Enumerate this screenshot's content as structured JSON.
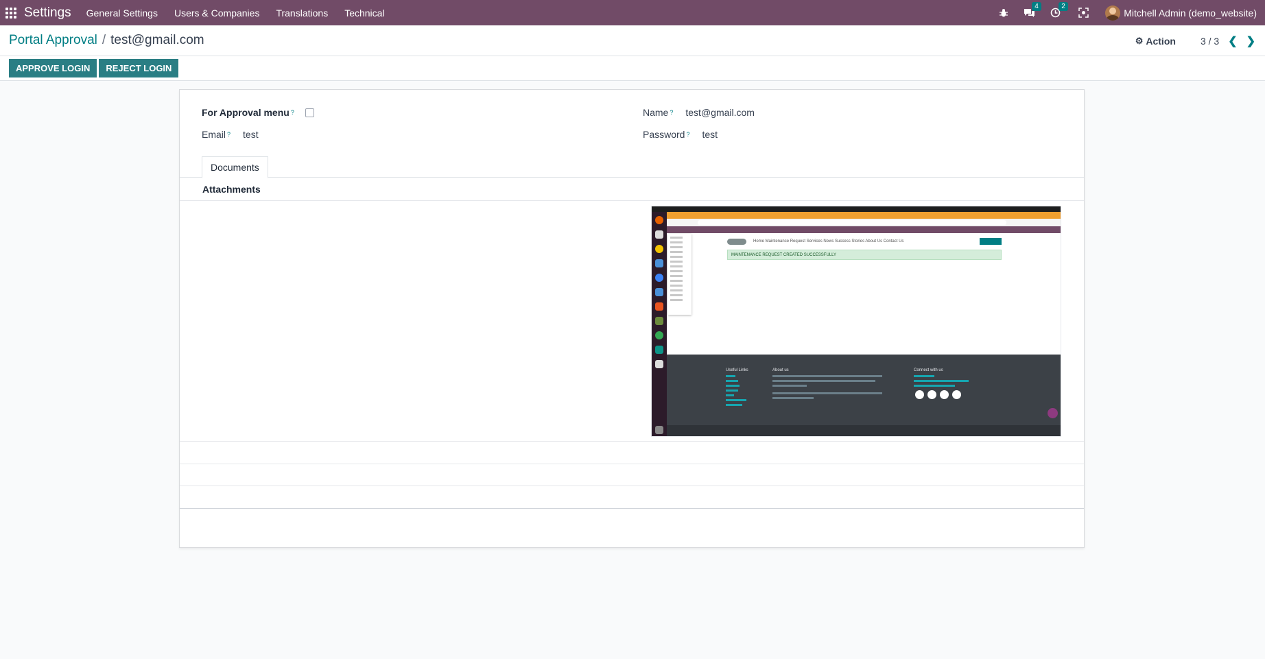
{
  "navbar": {
    "app_name": "Settings",
    "menu": [
      "General Settings",
      "Users & Companies",
      "Translations",
      "Technical"
    ],
    "messages_count": "4",
    "activities_count": "2",
    "user_name": "Mitchell Admin (demo_website)",
    "background_color": "#714b67"
  },
  "breadcrumb": {
    "parent": "Portal Approval",
    "separator": "/",
    "current": "test@gmail.com"
  },
  "control": {
    "action_label": "Action",
    "pager": "3 / 3"
  },
  "status_buttons": {
    "approve": "APPROVE LOGIN",
    "reject": "REJECT LOGIN",
    "color": "#2a7e84"
  },
  "form": {
    "approval_menu_label": "For Approval menu",
    "approval_menu_checked": false,
    "email_label": "Email",
    "email_value": "test",
    "name_label": "Name",
    "name_value": "test@gmail.com",
    "password_label": "Password",
    "password_value": "test",
    "help_mark": "?"
  },
  "tabs": {
    "documents": "Documents",
    "attachments_label": "Attachments"
  },
  "preview": {
    "alert_text": "MAINTENANCE REQUEST CREATED SUCCESSFULLY",
    "nav_text": "Home   Maintenance Request   Services   News   Success Stories   About Us   Contact Us",
    "footer_useful_links": "Useful Links",
    "footer_about": "About us",
    "footer_connect": "Connect with us"
  },
  "colors": {
    "accent": "#017e84",
    "brand": "#714b67"
  }
}
